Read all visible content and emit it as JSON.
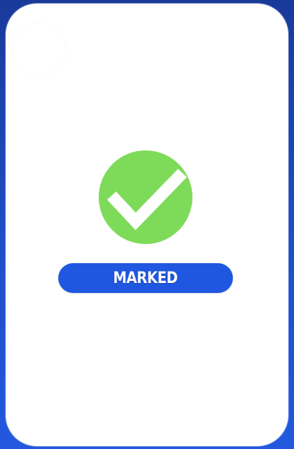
{
  "status": {
    "label": "MARKED",
    "icon": "check-icon",
    "colors": {
      "badge": "#7edb5a",
      "pill": "#1f57e0",
      "background": "#1f4fc7",
      "card": "#ffffff"
    }
  }
}
